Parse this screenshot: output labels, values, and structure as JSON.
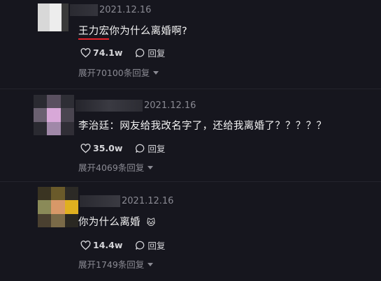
{
  "comments": [
    {
      "date": "2021.12.16",
      "text_prefix": "王力宏",
      "text": "你为什么离婚啊?",
      "likes": "74.1w",
      "reply_label": "回复",
      "expand_label": "展开70100条回复"
    },
    {
      "date": "2021.12.16",
      "text": "李治廷：网友给我改名字了，还给我离婚了？？？？？",
      "likes": "35.0w",
      "reply_label": "回复",
      "expand_label": "展开4069条回复"
    },
    {
      "date": "2021.12.16",
      "text": "你为什么离婚",
      "emoji": "🐱",
      "likes": "14.4w",
      "reply_label": "回复",
      "expand_label": "展开1749条回复"
    }
  ],
  "colors": {
    "background": "#16161e",
    "underline": "#e8232b",
    "meta": "#8a8a93"
  },
  "icons": [
    "heart-icon",
    "reply-bubble-icon",
    "chevron-down-icon"
  ]
}
